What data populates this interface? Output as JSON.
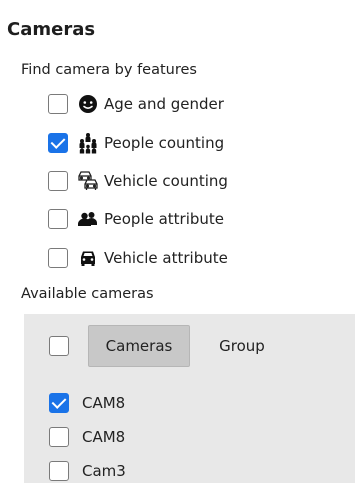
{
  "title": "Cameras",
  "find_label": "Find camera by features",
  "features": [
    {
      "label": "Age and gender",
      "checked": false,
      "icon": "face-icon"
    },
    {
      "label": "People counting",
      "checked": true,
      "icon": "people-group-icon"
    },
    {
      "label": "Vehicle counting",
      "checked": false,
      "icon": "vehicles-icon"
    },
    {
      "label": "People attribute",
      "checked": false,
      "icon": "people-icon"
    },
    {
      "label": "Vehicle attribute",
      "checked": false,
      "icon": "car-icon"
    }
  ],
  "available_label": "Available cameras",
  "panel": {
    "select_all_checked": false,
    "tabs": {
      "cameras": "Cameras",
      "group": "Group"
    },
    "cameras": [
      {
        "name": "CAM8",
        "checked": true
      },
      {
        "name": "CAM8",
        "checked": false
      },
      {
        "name": "Cam3",
        "checked": false
      }
    ]
  },
  "colors": {
    "accent": "#1a73e8",
    "panel_bg": "#e8e8e8",
    "active_tab_bg": "#c8c8c8"
  }
}
